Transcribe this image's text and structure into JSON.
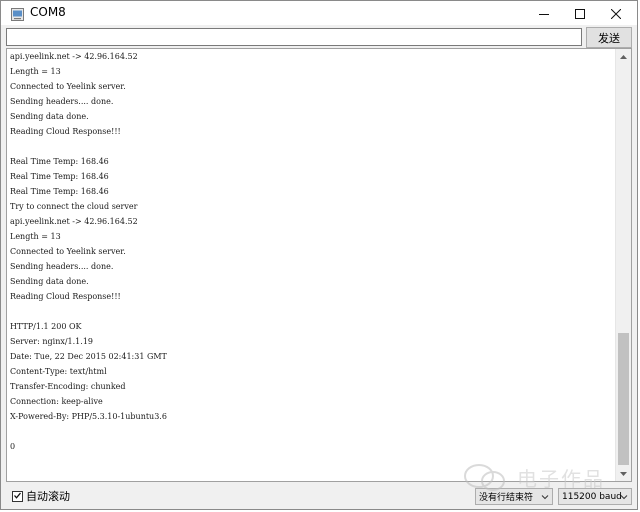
{
  "window": {
    "title": "COM8"
  },
  "send_bar": {
    "input_value": "",
    "send_label": "发送"
  },
  "output_lines": [
    "api.yeelink.net -> 42.96.164.52",
    "Length = 13",
    "Connected to Yeelink server.",
    "Sending headers.... done.",
    "Sending data done.",
    "Reading Cloud Response!!!",
    "",
    "Real Time Temp: 168.46",
    "Real Time Temp: 168.46",
    "Real Time Temp: 168.46",
    "Try to connect the cloud server",
    "api.yeelink.net -> 42.96.164.52",
    "Length = 13",
    "Connected to Yeelink server.",
    "Sending headers.... done.",
    "Sending data done.",
    "Reading Cloud Response!!!",
    "",
    "HTTP/1.1 200 OK",
    "Server: nginx/1.1.19",
    "Date: Tue, 22 Dec 2015 02:41:31 GMT",
    "Content-Type: text/html",
    "Transfer-Encoding: chunked",
    "Connection: keep-alive",
    "X-Powered-By: PHP/5.3.10-1ubuntu3.6",
    "",
    "0"
  ],
  "bottom_bar": {
    "autoscroll_label": "自动滚动",
    "autoscroll_checked": true,
    "line_ending_value": "没有行结束符",
    "baud_value": "115200 baud"
  },
  "watermark": {
    "text": "电子作品"
  },
  "icons": {
    "app": "serial-monitor-icon",
    "minimize": "minimize-icon",
    "maximize": "maximize-icon",
    "close": "close-icon",
    "scroll_up": "scroll-up-arrow-icon",
    "scroll_down": "scroll-down-arrow-icon",
    "dropdown": "chevron-down-icon",
    "checkmark": "checkmark-icon",
    "watermark_logo": "wechat-logo-icon"
  }
}
